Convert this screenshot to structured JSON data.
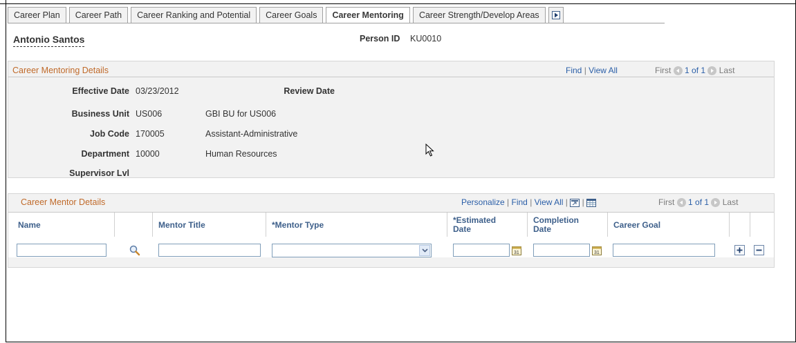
{
  "tabs": [
    "Career Plan",
    "Career Path",
    "Career Ranking and Potential",
    "Career Goals",
    "Career Mentoring",
    "Career Strength/Develop Areas"
  ],
  "active_tab": "Career Mentoring",
  "header": {
    "name": "Antonio Santos",
    "person_id_label": "Person ID",
    "person_id": "KU0010"
  },
  "details": {
    "title": "Career Mentoring Details",
    "nav": {
      "find": "Find",
      "view_all": "View All",
      "first": "First",
      "count": "1 of 1",
      "last": "Last"
    },
    "effective_date_label": "Effective Date",
    "effective_date": "03/23/2012",
    "review_date_label": "Review Date",
    "business_unit_label": "Business Unit",
    "business_unit": "US006",
    "business_unit_desc": "GBI BU for US006",
    "job_code_label": "Job Code",
    "job_code": "170005",
    "job_code_desc": "Assistant-Administrative",
    "department_label": "Department",
    "department": "10000",
    "department_desc": "Human Resources",
    "supervisor_lvl_label": "Supervisor Lvl"
  },
  "mentor_grid": {
    "title": "Career Mentor Details",
    "nav": {
      "personalize": "Personalize",
      "find": "Find",
      "view_all": "View All",
      "first": "First",
      "count": "1 of 1",
      "last": "Last"
    },
    "columns": [
      "Name",
      "Mentor Title",
      "*Mentor Type",
      "*Estimated Date",
      "Completion Date",
      "Career Goal"
    ],
    "col_estimated_1": "*Estimated",
    "col_estimated_2": "Date",
    "col_completion_1": "Completion",
    "col_completion_2": "Date",
    "row": {
      "name": "",
      "mentor_title": "",
      "mentor_type": "",
      "estimated_date": "",
      "completion_date": "",
      "career_goal": ""
    }
  }
}
